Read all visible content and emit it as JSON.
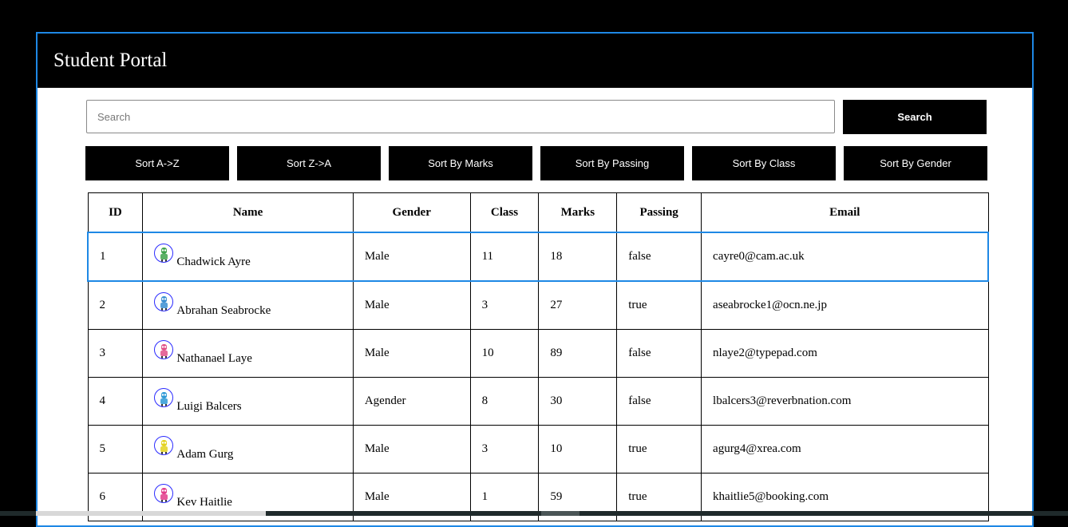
{
  "app": {
    "title": "Student Portal"
  },
  "search": {
    "placeholder": "Search",
    "value": "",
    "button_label": "Search"
  },
  "sort_buttons": [
    {
      "label": "Sort A->Z"
    },
    {
      "label": "Sort Z->A"
    },
    {
      "label": "Sort By Marks"
    },
    {
      "label": "Sort By Passing"
    },
    {
      "label": "Sort By Class"
    },
    {
      "label": "Sort By Gender"
    }
  ],
  "table": {
    "headers": [
      "ID",
      "Name",
      "Gender",
      "Class",
      "Marks",
      "Passing",
      "Email"
    ],
    "rows": [
      {
        "id": "1",
        "name": "Chadwick Ayre",
        "gender": "Male",
        "class": "11",
        "marks": "18",
        "passing": "false",
        "email": "cayre0@cam.ac.uk",
        "avatar_color": "#3fa34d",
        "avatar_icon": "robot-avatar-icon"
      },
      {
        "id": "2",
        "name": "Abrahan Seabrocke",
        "gender": "Male",
        "class": "3",
        "marks": "27",
        "passing": "true",
        "email": "aseabrocke1@ocn.ne.jp",
        "avatar_color": "#3b8fd1",
        "avatar_icon": "robot-avatar-icon"
      },
      {
        "id": "3",
        "name": "Nathanael Laye",
        "gender": "Male",
        "class": "10",
        "marks": "89",
        "passing": "false",
        "email": "nlaye2@typepad.com",
        "avatar_color": "#e0508a",
        "avatar_icon": "robot-avatar-icon"
      },
      {
        "id": "4",
        "name": "Luigi Balcers",
        "gender": "Agender",
        "class": "8",
        "marks": "30",
        "passing": "false",
        "email": "lbalcers3@reverbnation.com",
        "avatar_color": "#2f9ad6",
        "avatar_icon": "robot-avatar-icon"
      },
      {
        "id": "5",
        "name": "Adam Gurg",
        "gender": "Male",
        "class": "3",
        "marks": "10",
        "passing": "true",
        "email": "agurg4@xrea.com",
        "avatar_color": "#e3d21e",
        "avatar_icon": "robot-avatar-icon"
      },
      {
        "id": "6",
        "name": "Kev Haitlie",
        "gender": "Male",
        "class": "1",
        "marks": "59",
        "passing": "true",
        "email": "khaitlie5@booking.com",
        "avatar_color": "#e23d8b",
        "avatar_icon": "robot-avatar-icon"
      }
    ]
  },
  "colors": {
    "accent": "#1e88e5",
    "header_bg": "#000000",
    "button_bg": "#000000",
    "avatar_border": "#2a2aff"
  }
}
